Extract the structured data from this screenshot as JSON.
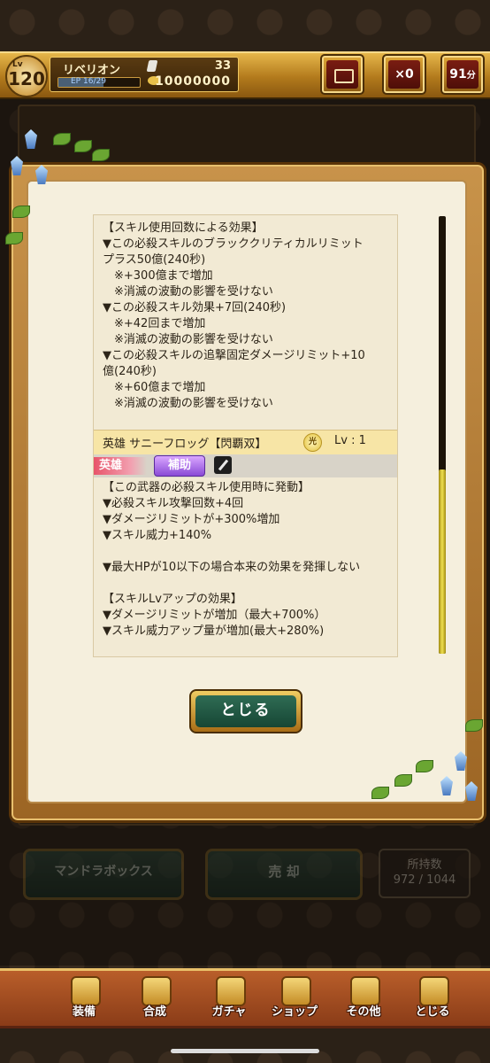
{
  "header": {
    "level_label": "Lv",
    "level": "120",
    "player_name": "リベリオン",
    "ep_label": "EP",
    "ep_value": "16/29",
    "ep_fill": 0.55,
    "gems": "33",
    "gold": "10000000",
    "gift_count": "×0",
    "timer": "91",
    "timer_unit": "分"
  },
  "background_menu": {
    "mandra_box_label": "マンドラボックス",
    "sell_label": "売 却",
    "owned_label": "所持数",
    "owned_value": "972 / 1044"
  },
  "dialog": {
    "effect_lines": [
      "【スキル使用回数による効果】",
      "▼この必殺スキルのブラッククリティカルリミット",
      "プラス50億(240秒)",
      "　※+300億まで増加",
      "　※消滅の波動の影響を受けない",
      "▼この必殺スキル効果+7回(240秒)",
      "　※+42回まで増加",
      "　※消滅の波動の影響を受けない",
      "▼この必殺スキルの追撃固定ダメージリミット+10",
      "億(240秒)",
      "　※+60億まで増加",
      "　※消滅の波動の影響を受けない"
    ],
    "item_name": "英雄 サニーフロッグ【閃覇双】",
    "element_icon": "光",
    "item_level": "Lv : 1",
    "tag_hero": "英雄",
    "tag_support": "補助",
    "weapon_icon": "sword-icon",
    "weapon_lines": [
      "【この武器の必殺スキル使用時に発動】",
      "▼必殺スキル攻撃回数+4回",
      "▼ダメージリミットが+300%増加",
      "▼スキル威力+140%",
      "",
      "▼最大HPが10以下の場合本来の効果を発揮しない",
      "",
      "【スキルLvアップの効果】",
      "▼ダメージリミットが増加（最大+700%）",
      "▼スキル威力アップ量が増加(最大+280%)"
    ],
    "close_label": "とじる"
  },
  "bottom_nav": {
    "items": [
      {
        "label": "装備",
        "icon": "equipment-icon"
      },
      {
        "label": "合成",
        "icon": "hammer-icon"
      },
      {
        "label": "ガチャ",
        "icon": "gacha-icon"
      },
      {
        "label": "ショップ",
        "icon": "shop-crystal-icon"
      },
      {
        "label": "その他",
        "icon": "gear-icon"
      },
      {
        "label": "とじる",
        "icon": "close-statue-icon"
      }
    ]
  }
}
